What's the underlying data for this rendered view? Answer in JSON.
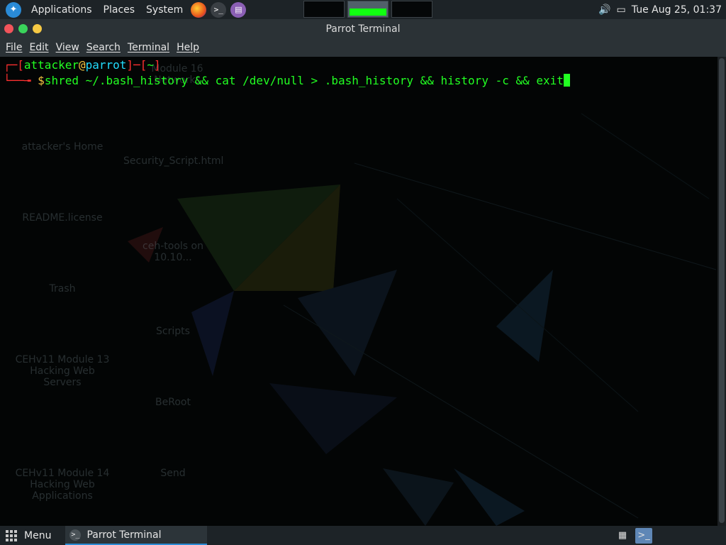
{
  "top_panel": {
    "applications_label": "Applications",
    "places_label": "Places",
    "system_label": "System",
    "clock": "Tue Aug 25, 01:37"
  },
  "window": {
    "title": "Parrot Terminal",
    "menu": [
      "File",
      "Edit",
      "View",
      "Search",
      "Terminal",
      "Help"
    ]
  },
  "terminal": {
    "user": "attacker",
    "at": "@",
    "host": "parrot",
    "path": "~",
    "dollar": "$",
    "command": "shred ~/.bash_history && cat /dev/null > .bash_history && history -c && exit"
  },
  "desktop_icons": [
    "Module 16 Networks",
    "attacker's Home",
    "Security_Script.html",
    "README.license",
    "ceh-tools on 10.10...",
    "Trash",
    "Scripts",
    "CEHv11 Module 13 Hacking Web Servers",
    "BeRoot",
    "CEHv11 Module 14 Hacking Web Applications",
    "Send"
  ],
  "bottom_panel": {
    "menu_label": "Menu",
    "task_label": "Parrot Terminal"
  },
  "colors": {
    "prompt_red": "#ff3030",
    "prompt_green": "#22ff22",
    "accent": "#2a8bd6"
  }
}
